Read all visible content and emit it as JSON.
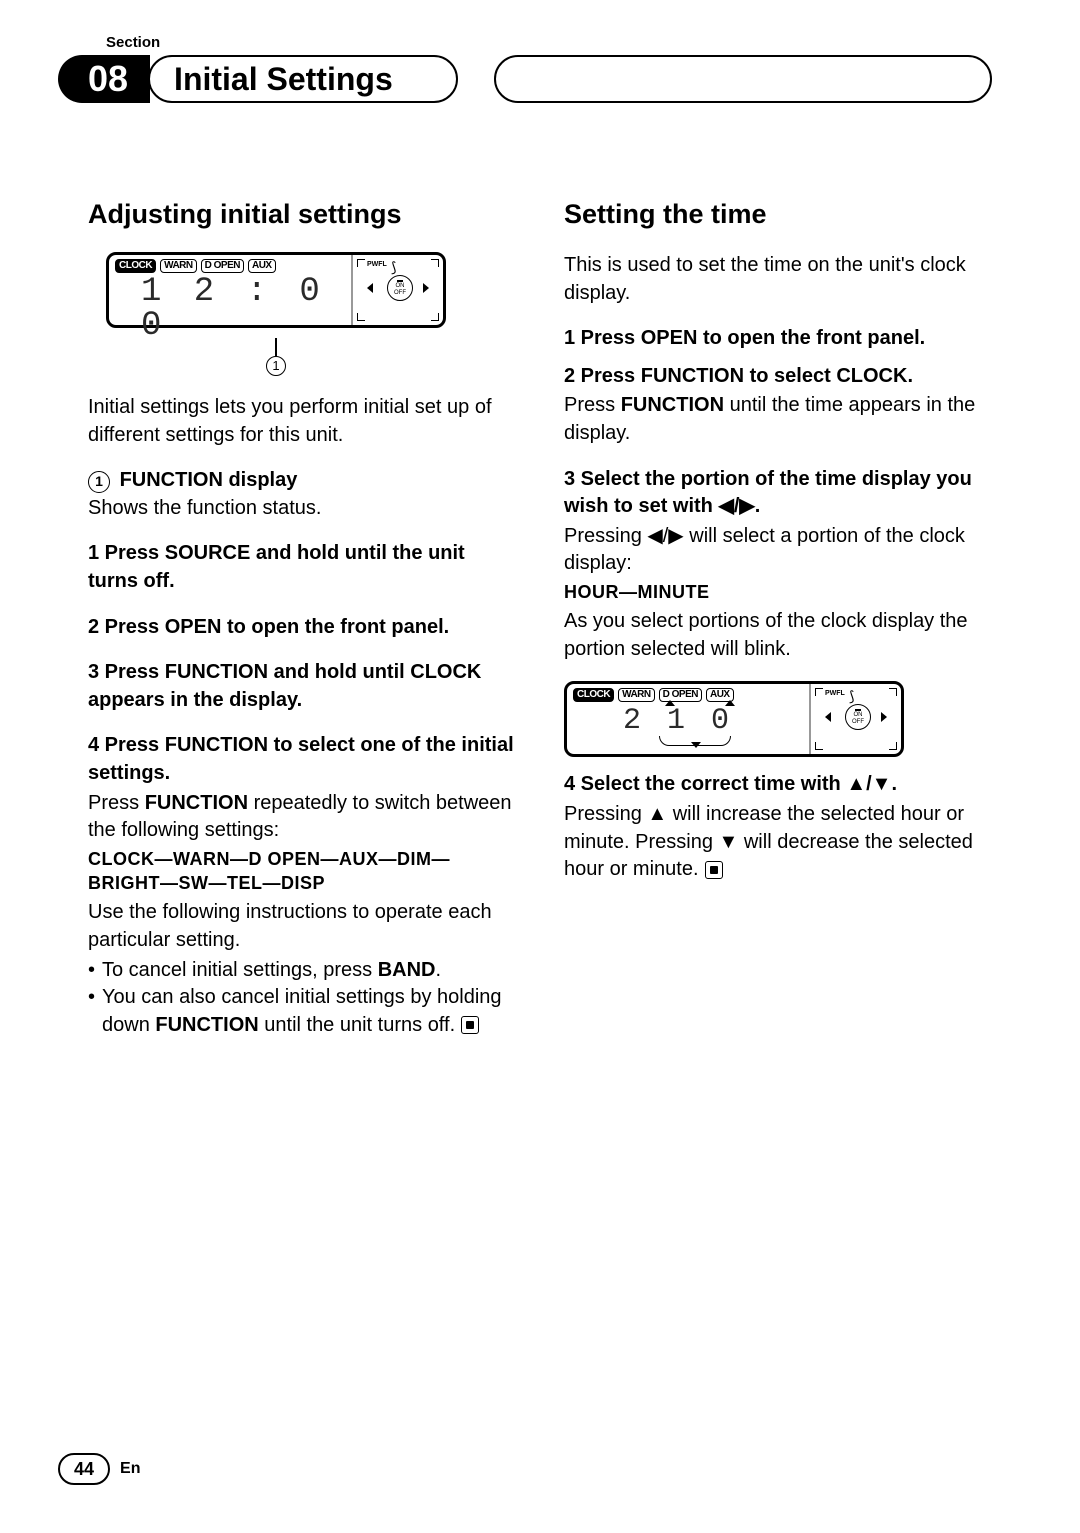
{
  "section_label": "Section",
  "chapter_number": "08",
  "chapter_title": "Initial Settings",
  "left": {
    "heading": "Adjusting initial settings",
    "lcd": {
      "tags": [
        "CLOCK",
        "WARN",
        "D OPEN",
        "AUX"
      ],
      "time": "1 2 : 0 0",
      "pwfl": "PWFL",
      "on": "ON",
      "off": "OFF"
    },
    "callout_num": "1",
    "intro": "Initial settings lets you perform initial set up of different settings for this unit.",
    "func_display_label": "FUNCTION display",
    "func_display_desc": "Shows the function status.",
    "step1_pre": "1   Press ",
    "step1_b1": "SOURCE",
    "step1_mid": " and hold until the unit turns off.",
    "step2_pre": "2   Press ",
    "step2_b1": "OPEN",
    "step2_mid": " to open the front panel.",
    "step3_pre": "3   Press ",
    "step3_b1": "FUNCTION",
    "step3_mid": " and hold until ",
    "step3_b2": "CLOCK",
    "step3_end": " appears in the display.",
    "step4_pre": "4   Press ",
    "step4_b1": "FUNCTION",
    "step4_mid": " to select one of the initial settings.",
    "step4_desc_a": "Press ",
    "step4_desc_b": "FUNCTION",
    "step4_desc_c": " repeatedly to switch between the following settings:",
    "seq": "CLOCK—WARN—D OPEN—AUX—DIM—BRIGHT—SW—TEL—DISP",
    "use_following": "Use the following instructions to operate each particular setting.",
    "bullet1_a": "To cancel initial settings, press ",
    "bullet1_b": "BAND",
    "bullet1_c": ".",
    "bullet2_a": "You can also cancel initial settings by holding down ",
    "bullet2_b": "FUNCTION",
    "bullet2_c": " until the unit turns off."
  },
  "right": {
    "heading": "Setting the time",
    "intro": "This is used to set the time on the unit's clock display.",
    "step1_pre": "1   Press ",
    "step1_b1": "OPEN",
    "step1_mid": " to open the front panel.",
    "step2_pre": "2   Press ",
    "step2_b1": "FUNCTION",
    "step2_mid": " to select ",
    "step2_b2": "CLOCK",
    "step2_end": ".",
    "step2_desc_a": "Press ",
    "step2_desc_b": "FUNCTION",
    "step2_desc_c": " until the time appears in the display.",
    "step3_full": "3   Select the portion of the time display you wish to set with ◀/▶.",
    "step3_desc": "Pressing ◀/▶ will select a portion of the clock display:",
    "hour_minute": "HOUR—MINUTE",
    "blink_desc": "As you select portions of the clock display the portion selected will blink.",
    "lcd": {
      "tags": [
        "CLOCK",
        "WARN",
        "D OPEN",
        "AUX"
      ],
      "time": "2   1 0",
      "pwfl": "PWFL",
      "on": "ON",
      "off": "OFF"
    },
    "step4_full": "4   Select the correct time with ▲/▼.",
    "step4_desc": "Pressing ▲ will increase the selected hour or minute. Pressing ▼ will decrease the selected hour or minute."
  },
  "footer": {
    "page": "44",
    "lang": "En"
  }
}
